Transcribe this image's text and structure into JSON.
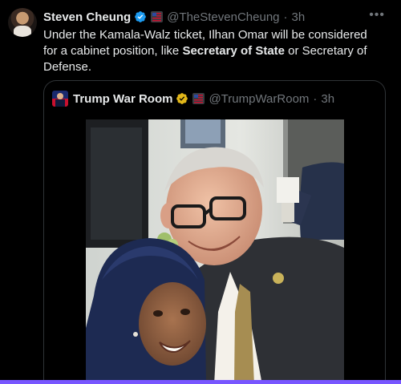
{
  "tweet": {
    "author_name": "Steven Cheung",
    "author_handle": "@TheStevenCheung",
    "separator": "·",
    "time": "3h",
    "more_icon": "more-horizontal-icon",
    "text_part1": "Under the Kamala-Walz ticket, Ilhan Omar will be considered for a cabinet position, like ",
    "text_bold": "Secretary of State",
    "text_part2": " or Secretary of Defense."
  },
  "quote": {
    "author_name": "Trump War Room",
    "author_handle": "@TrumpWarRoom",
    "separator": "·",
    "time": "3h"
  },
  "colors": {
    "background": "#000000",
    "text": "#e7e9ea",
    "secondary_text": "#71767b",
    "verified_blue": "#1d9bf0",
    "verified_gold": "#e2b719",
    "border": "#2f3336",
    "accent_bar": "#7856ff"
  }
}
